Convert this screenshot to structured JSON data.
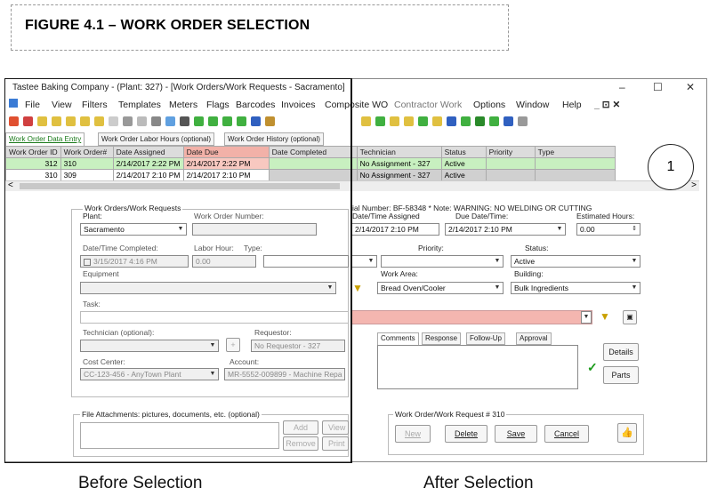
{
  "figure": {
    "title": "FIGURE 4.1 – WORK ORDER SELECTION"
  },
  "window": {
    "title": "Tastee Baking Company - (Plant: 327) - [Work Orders/Work Requests - Sacramento]",
    "min_icon": "–",
    "max_icon": "☐",
    "close_icon": "✕"
  },
  "menu": [
    "File",
    "View",
    "Filters",
    "Templates",
    "Meters",
    "Flags",
    "Barcodes",
    "Invoices",
    "Composite WO",
    "Contractor Work",
    "Options",
    "Window",
    "Help"
  ],
  "menu_right": "_ ⊡ ✕",
  "tabs": [
    "Work Order Data Entry",
    "Work Order Labor Hours (optional)",
    "Work Order History (optional)"
  ],
  "grid": {
    "headers": [
      "Work Order ID",
      "Work Order#",
      "Date Assigned",
      "Date Due",
      "Date Completed",
      "Technician",
      "Status",
      "Priority",
      "Type"
    ],
    "rows": [
      [
        "312",
        "310",
        "2/14/2017 2:22 PM",
        "2/14/2017 2:22 PM",
        "",
        "No Assignment - 327",
        "Active",
        "",
        ""
      ],
      [
        "310",
        "309",
        "2/14/2017 2:10 PM",
        "2/14/2017 2:10 PM",
        "",
        "No Assignment - 327",
        "Active",
        "",
        ""
      ]
    ]
  },
  "form": {
    "group_label": "Work Orders/Work Requests",
    "plant_label": "Plant:",
    "plant_value": "Sacramento",
    "wo_number_label": "Work Order Number:",
    "serial_note": "ial Number: BF-58348 * Note: WARNING: NO WELDING OR CUTTING",
    "date_assigned_label": "Date/Time Assigned",
    "date_assigned_value": "2/14/2017  2:10 PM",
    "due_label": "Due Date/Time:",
    "due_value": "2/14/2017  2:10 PM",
    "est_hours_label": "Estimated Hours:",
    "est_hours_value": "0.00",
    "completed_label": "Date/Time Completed:",
    "completed_value": "3/15/2017  4:16 PM",
    "labor_label": "Labor Hour:",
    "labor_value": "0.00",
    "type_label": "Type:",
    "priority_label": "Priority:",
    "status_label": "Status:",
    "status_value": "Active",
    "equipment_label": "Equipment",
    "work_area_label": "Work Area:",
    "work_area_value": "Bread Oven/Cooler",
    "building_label": "Building:",
    "building_value": "Bulk Ingredients",
    "task_label": "Task:",
    "technician_label": "Technician (optional):",
    "requestor_label": "Requestor:",
    "requestor_value": "No Requestor - 327",
    "cost_center_label": "Cost Center:",
    "cost_center_value": "CC-123-456 - AnyTown Plant",
    "account_label": "Account:",
    "account_value": "MR-5552-009899 - Machine Repa",
    "comment_tabs": [
      "Comments",
      "Response",
      "Follow-Up",
      "Approval"
    ],
    "details_btn": "Details",
    "parts_btn": "Parts",
    "attach_label": "File Attachments: pictures, documents, etc. (optional)",
    "add_btn": "Add",
    "remove_btn": "Remove",
    "view_btn": "View",
    "print_btn": "Print",
    "wo_group_label": "Work Order/Work Request # 310",
    "new_btn": "New",
    "delete_btn": "Delete",
    "save_btn": "Save",
    "cancel_btn": "Cancel",
    "plus_btn": "+"
  },
  "callout": "1",
  "captions": {
    "before": "Before Selection",
    "after": "After Selection"
  },
  "colors": {
    "selected_row": "#c8f0c0",
    "due_header": "#f2b1a8",
    "task_field": "#f4b6b0"
  }
}
